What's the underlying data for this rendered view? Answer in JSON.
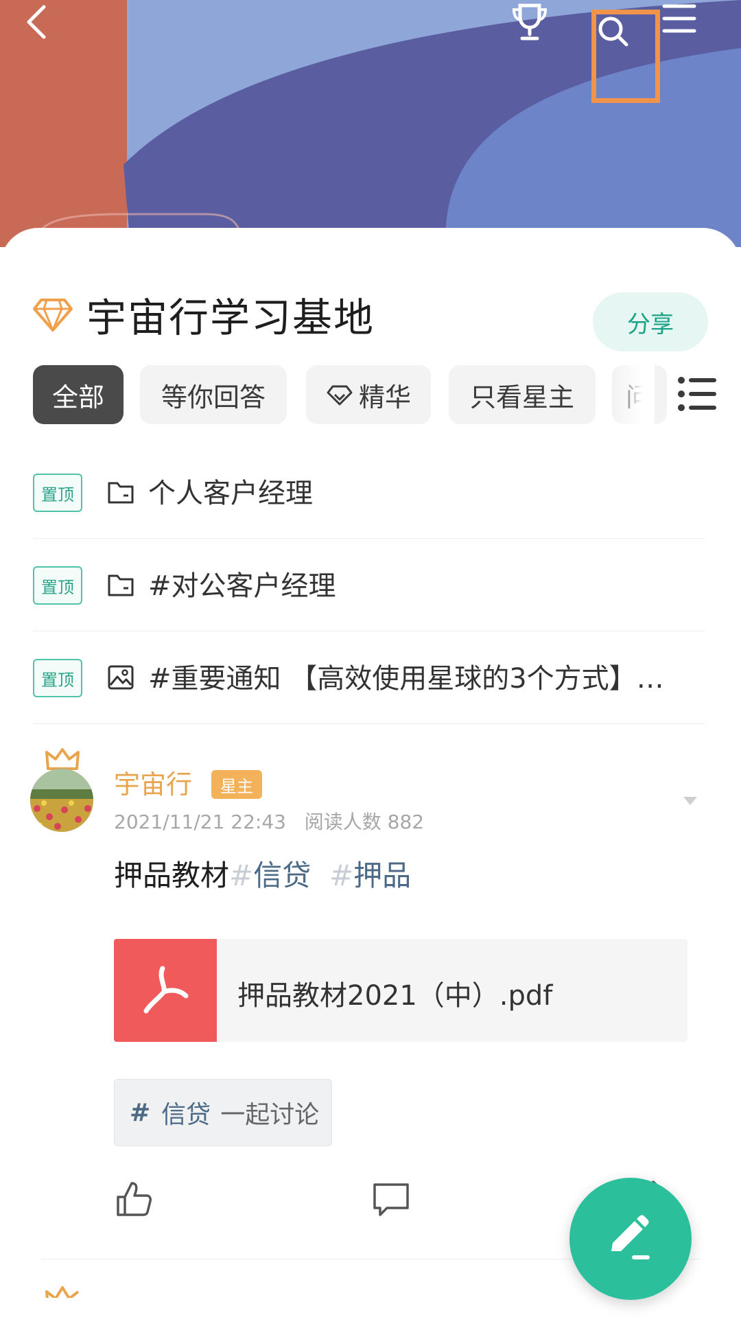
{
  "header": {
    "back_icon": "chevron-left-icon",
    "trophy_icon": "trophy-icon",
    "search_icon": "search-icon",
    "menu_icon": "menu-icon",
    "highlight_color": "#f0944a"
  },
  "group": {
    "title": "宇宙行学习基地",
    "share_label": "分享",
    "accent": "#2bbf9c"
  },
  "tabs": [
    {
      "label": "全部",
      "active": true
    },
    {
      "label": "等你回答"
    },
    {
      "label": "精华",
      "icon": "diamond-outline-icon"
    },
    {
      "label": "只看星主"
    },
    {
      "label": "问"
    }
  ],
  "pinned": [
    {
      "badge": "置顶",
      "icon": "folder-icon",
      "text": "个人客户经理"
    },
    {
      "badge": "置顶",
      "icon": "folder-icon",
      "text": "#对公客户经理"
    },
    {
      "badge": "置顶",
      "icon": "image-icon",
      "text": "#重要通知  【高效使用星球的3个方式】…"
    }
  ],
  "post": {
    "author": "宇宙行",
    "author_badge": "星主",
    "time": "2021/11/21 22:43",
    "read_label": "阅读人数",
    "read_count": "882",
    "text": "押品教材",
    "hash1": "#",
    "tag1": "信贷",
    "hash2": "#",
    "tag2": "押品",
    "file_name": "押品教材2021（中）.pdf",
    "topic_hash": "#",
    "topic_name": "信贷",
    "topic_suffix": "一起讨论"
  },
  "fab_icon": "pencil-icon"
}
